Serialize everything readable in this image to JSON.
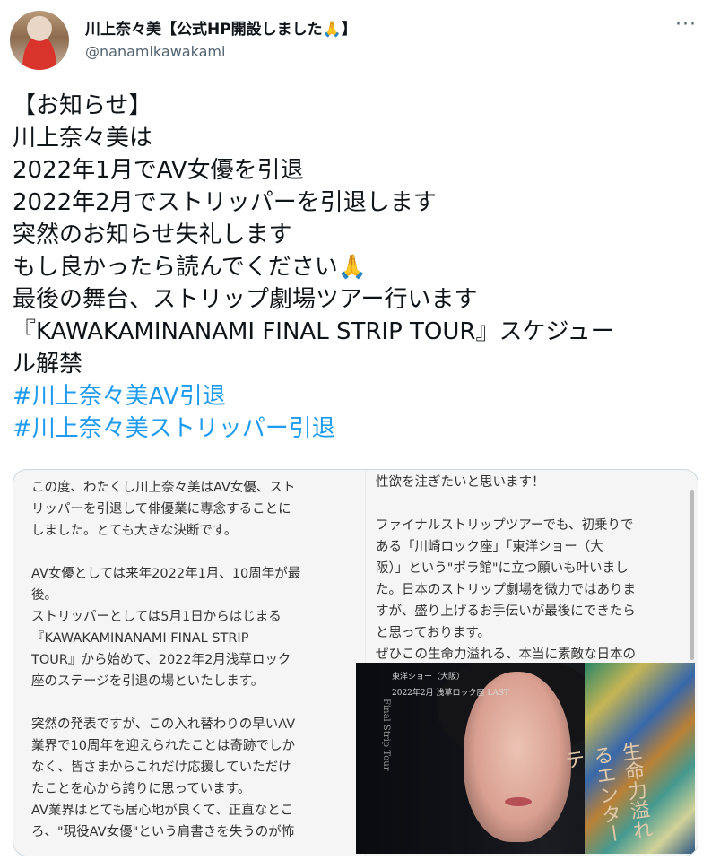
{
  "user": {
    "display_name": "川上奈々美【公式HP開設しました",
    "display_name_suffix": "】",
    "handle": "@nanamikawakami",
    "more_label": "···"
  },
  "emoji": {
    "folded_hands": "🙏"
  },
  "tweet": {
    "lines": [
      "【お知らせ】",
      "川上奈々美は",
      "2022年1月でAV女優を引退",
      "2022年2月でストリッパーを引退します",
      "突然のお知らせ失礼します",
      "もし良かったら読んでください",
      "最後の舞台、ストリップ劇場ツアー行います",
      "『KAWAKAMINANAMI FINAL STRIP TOUR』スケジュー",
      "ル解禁"
    ],
    "hashtags": [
      "#川上奈々美AV引退",
      "#川上奈々美ストリッパー引退"
    ]
  },
  "media": {
    "left_paragraphs": [
      "この度、わたくし川上奈々美はAV女優、スト\nリッパーを引退して俳優業に専念することに\nしました。とても大きな決断です。",
      "AV女優としては来年2022年1月、10周年が最\n後。\nストリッパーとしては5月1日からはじまる\n『KAWAKAMINANAMI FINAL STRIP\nTOUR』から始めて、2022年2月浅草ロック\n座のステージを引退の場といたします。",
      "突然の発表ですが、この入れ替わりの早いAV\n業界で10周年を迎えられたことは奇跡でしか\nなく、皆さまからこれだけ応援していただけ\nたことを心から誇りに思っています。\nAV業界はとても居心地が良くて、正直なとこ\nろ、\"現役AV女優\"という肩書きを失うのが怖"
    ],
    "right_paragraphs": [
      "性欲を注ぎたいと思います！",
      "ファイナルストリップツアーでも、初乗りで\nある「川崎ロック座」「東洋ショー（大\n阪）」という\"ポラ館\"に立つ願いも叶いまし\nた。日本のストリップ劇場を微力ではありま\nすが、盛り上げるお手伝いが最後にできたら\nと思っております。\nぜひこの生命力溢れる、本当に素敵な日本の"
    ],
    "poster": {
      "line1": "東洋ショー（大阪）",
      "line2": "2022年2月 浅草ロック座 LAST",
      "line3": "",
      "vertical": "Final Strip Tour",
      "catch": "生命力溢れるエンターテ"
    }
  }
}
